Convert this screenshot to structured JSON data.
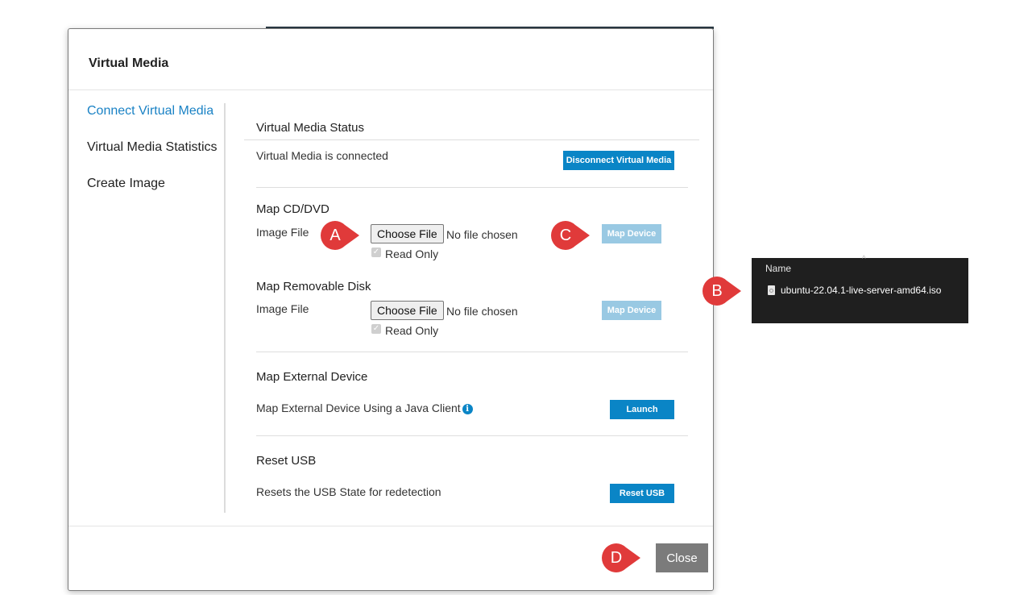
{
  "modal": {
    "title": "Virtual Media",
    "nav": [
      "Connect Virtual Media",
      "Virtual Media Statistics",
      "Create Image"
    ],
    "status": {
      "title": "Virtual Media Status",
      "text": "Virtual Media is connected",
      "button": "Disconnect Virtual Media"
    },
    "cd": {
      "title": "Map CD/DVD",
      "label": "Image File",
      "choose": "Choose File",
      "nofile": "No file chosen",
      "readonly": "Read Only",
      "map": "Map Device"
    },
    "removable": {
      "title": "Map Removable Disk",
      "label": "Image File",
      "choose": "Choose File",
      "nofile": "No file chosen",
      "readonly": "Read Only",
      "map": "Map Device"
    },
    "external": {
      "title": "Map External Device",
      "text": "Map External Device Using a Java Client",
      "button": "Launch"
    },
    "usb": {
      "title": "Reset USB",
      "text": "Resets the USB State for redetection",
      "button": "Reset USB"
    },
    "close": "Close"
  },
  "callouts": {
    "a": "A",
    "b": "B",
    "c": "C",
    "d": "D"
  },
  "explorer": {
    "header": "Name",
    "file": "ubuntu-22.04.1-live-server-amd64.iso"
  },
  "colors": {
    "accent": "#0a85c6",
    "callout": "#e03a3a",
    "nav_active": "#1a82c5",
    "close": "#7b7b7b"
  },
  "icons": [
    "info-icon",
    "file-icon",
    "sort-caret-icon"
  ]
}
